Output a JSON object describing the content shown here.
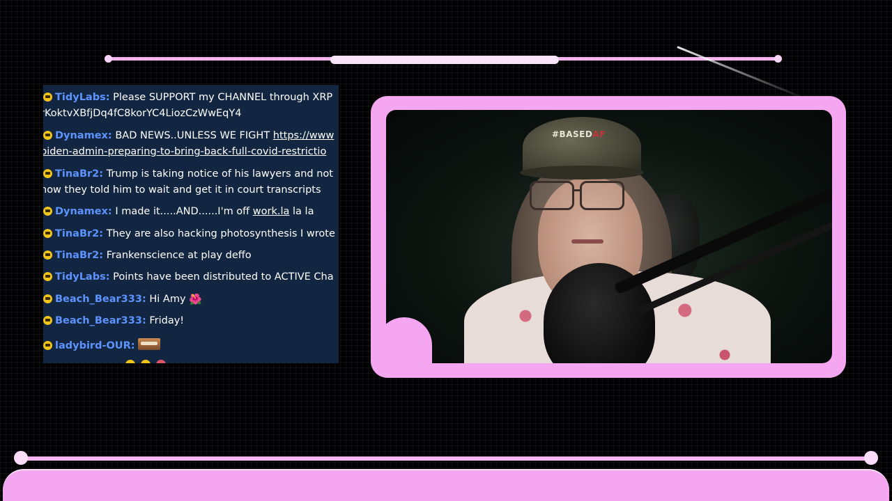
{
  "chat": {
    "messages": [
      {
        "user": "TidyLabs",
        "line1": "Please SUPPORT my CHANNEL through XRP",
        "line2": "rKoktvXBfjDq4fC8korYC4LiozCzWwEqY4"
      },
      {
        "user": "Dynamex",
        "text": "BAD NEWS..UNLESS WE FIGHT ",
        "link": "https://www",
        "line2": "biden-admin-preparing-to-bring-back-full-covid-restrictio"
      },
      {
        "user": "TinaBr2",
        "line1": "Trump is taking notice of his lawyers and not",
        "line2": "how they told him to wait and get it in court transcripts"
      },
      {
        "user": "Dynamex",
        "text": "I made it.....AND......I'm off ",
        "link": "work.la",
        "tail": " la la"
      },
      {
        "user": "TinaBr2",
        "line1": "They are also hacking photosynthesis I wrote"
      },
      {
        "user": "TinaBr2",
        "line1": "Frankenscience at play deffo"
      },
      {
        "user": "TidyLabs",
        "line1": "Points have been distributed to ACTIVE Cha"
      },
      {
        "user": "Beach_Bear333",
        "line1": "Hi Amy ",
        "emoji": "🌺"
      },
      {
        "user": "Beach_Bear333",
        "line1": "Friday!"
      },
      {
        "user": "ladybird-OUR",
        "line1": ""
      }
    ]
  },
  "camera": {
    "cap_text_a": "#BASED",
    "cap_text_b": "AF"
  },
  "colors": {
    "frame": "#f4a7f0",
    "chat_bg": "#132641",
    "username": "#5d93ff"
  },
  "icons": {
    "badge": "badge-icon",
    "emote": "emote-icon"
  }
}
